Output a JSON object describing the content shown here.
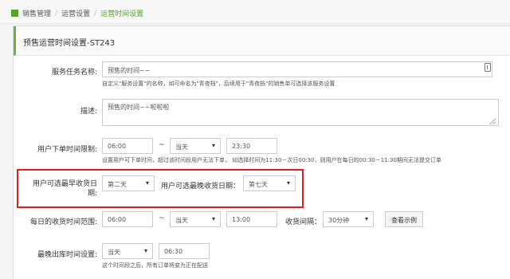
{
  "breadcrumb": {
    "items": [
      "销售管理",
      "运营设置",
      "运营时间设置"
    ],
    "sep": "/"
  },
  "panel": {
    "title": "预售运营时间设置-ST243"
  },
  "form": {
    "service_name": {
      "label": "服务任务名称:",
      "value": "预售的时间~~",
      "help": "自定义\"服务设置\"的名称，如可命名为\"青夜档\"，后续用于\"青夜档\"的销售单可选择该服务设置"
    },
    "description": {
      "label": "描述:",
      "value": "预售的时间~~啦啦啦"
    },
    "order_time": {
      "label": "用户下单时间限制:",
      "start": "06:00",
      "tilde": "~",
      "day": "当天",
      "end": "23:30",
      "help": "设置用户可下单时间，超过该时间段用户无法下单，  如选择时间为11:30－次日00:30，则用户在每日的00:30－11:30期间无法提交订单"
    },
    "earliest_receive": {
      "label_line1": "用户可选最早收货日",
      "label_line2": "期:",
      "value": "第二天"
    },
    "latest_receive": {
      "label": "用户可选最晚收货日期：",
      "value": "第七天"
    },
    "daily_range": {
      "label": "每日的收货时间范围:",
      "start": "06:00",
      "tilde": "~",
      "day": "当天",
      "end": "13:00",
      "interval_label": "收货间隔：",
      "interval": "30分钟",
      "example_button": "查看示例"
    },
    "latest_out": {
      "label": "最晚出库时间设置:",
      "day": "当天",
      "time": "06:30",
      "help": "这个时间段之后，所有订单将变为正在配送"
    }
  },
  "icons": {
    "dropdown": "▾",
    "clip": "clipboard-icon"
  }
}
